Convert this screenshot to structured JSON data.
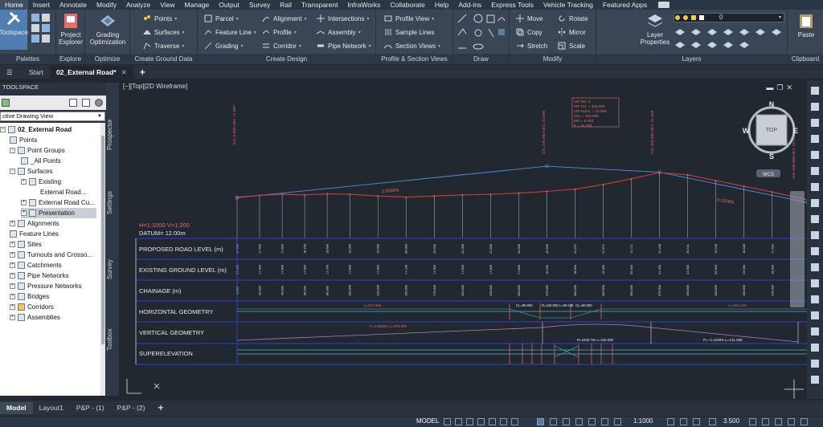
{
  "menu": [
    "Home",
    "Insert",
    "Annotate",
    "Modify",
    "Analyze",
    "View",
    "Manage",
    "Output",
    "Survey",
    "Rail",
    "Transparent",
    "InfraWorks",
    "Collaborate",
    "Help",
    "Add-ins",
    "Express Tools",
    "Vehicle Tracking",
    "Featured Apps"
  ],
  "ribbon": {
    "palettes": {
      "toolspace": "Toolspace",
      "title": "Palettes"
    },
    "explore": {
      "project_explorer": "Project Explorer",
      "title": "Explore"
    },
    "optimize": {
      "grading_optimization": "Grading Optimization",
      "title": "Optimize"
    },
    "ground": {
      "points": "Points",
      "surfaces": "Surfaces",
      "traverse": "Traverse",
      "title": "Create Ground Data"
    },
    "design": {
      "parcel": "Parcel",
      "feature_line": "Feature Line",
      "grading": "Grading",
      "alignment": "Alignment",
      "profile": "Profile",
      "corridor": "Corridor",
      "intersections": "Intersections",
      "assembly": "Assembly",
      "pipe_network": "Pipe Network",
      "title": "Create Design"
    },
    "profile_section": {
      "profile_view": "Profile View",
      "sample_lines": "Sample Lines",
      "section_views": "Section Views",
      "title": "Profile & Section Views"
    },
    "draw": {
      "title": "Draw"
    },
    "modify": {
      "move": "Move",
      "copy": "Copy",
      "stretch": "Stretch",
      "rotate": "Rotate",
      "mirror": "Mirror",
      "scale": "Scale",
      "title": "Modify"
    },
    "layers": {
      "layer_properties": "Layer Properties",
      "current_layer": "0",
      "title": "Layers"
    },
    "clipboard": {
      "paste": "Paste",
      "title": "Clipboard"
    }
  },
  "doc_tabs": {
    "start": "Start",
    "active": "02_External Road*"
  },
  "toolspace": {
    "title": "TOOLSPACE",
    "view_selector": "ctive Drawing View",
    "tree": [
      "02_External Road",
      "Points",
      "Point Groups",
      "_All Points",
      "Surfaces",
      "Existing",
      "External Road...",
      "External Road Cu...",
      "Presentation",
      "Alignments",
      "Feature Lines",
      "Sites",
      "Turnouts and Crosso...",
      "Catchments",
      "Pipe Networks",
      "Pressure Networks",
      "Bridges",
      "Corridors",
      "Assemblies"
    ],
    "side_tabs": [
      "Prospector",
      "Settings",
      "Survey",
      "Toolbox"
    ]
  },
  "viewport": {
    "label": "[−][Top][2D Wireframe]",
    "viewcube": {
      "n": "N",
      "s": "S",
      "e": "E",
      "w": "W",
      "top": "TOP",
      "wcs": "WCS"
    }
  },
  "profile": {
    "scale_note": "H=1:1000  V=1:200",
    "datum": "DATUM= 12.00m",
    "rows": [
      "PROPOSED ROAD LEVEL (m)",
      "EXISTING GROUND LEVEL (m)",
      "CHAINAGE (m)",
      "HORIZONTAL GEOMETRY",
      "VERTICAL GEOMETRY",
      "SUPERELEVATION"
    ],
    "grade_left": "2.0000%",
    "grade_right": "-4.1028%",
    "vip_box": [
      "VIP NO. 2",
      "VIP CH. = 325.000",
      "VIP ELEV. = 23.500",
      "VCL = 100.000",
      "MO = 0.763",
      "K = 16.288"
    ],
    "hg_labels": [
      "L=247.816",
      "CL=80.000",
      "R=125.000 L=80.036",
      "CL=80.000",
      "L=152.144"
    ],
    "vg_labels": [
      "P=2.0000% L=270.000",
      "P=−4.1028% L=131.558"
    ],
    "se_label": "R=1630.75x L=100.000",
    "top_labels": [
      "CH. 0.000 LEV. 17.000",
      "CH. 275.000 LEV. 22.500",
      "CH. 375.000 LEV. 21.448",
      "CH. 506.558 LEV. 16.151"
    ]
  },
  "chart_data": {
    "type": "line",
    "xlabel": "CHAINAGE (m)",
    "ylabel": "",
    "xlim": [
      0,
      506.558
    ],
    "series": [
      {
        "name": "",
        "x": [
          0,
          275,
          375,
          506.558
        ],
        "y": [
          17.0,
          22.5,
          21.448,
          16.151
        ]
      },
      {
        "name": "",
        "x": [
          0,
          20,
          40,
          60,
          80,
          100,
          125,
          150,
          175,
          200,
          225,
          250,
          275,
          300,
          325,
          350,
          375,
          400,
          425,
          450,
          475,
          506.558
        ],
        "y": [
          17.1,
          17.4,
          17.6,
          17.5,
          17.7,
          17.6,
          17.3,
          17.1,
          17.3,
          17.5,
          17.6,
          17.8,
          18.1,
          18.5,
          19.3,
          20.3,
          21.4,
          21.0,
          20.0,
          19.0,
          18.0,
          16.6
        ]
      }
    ]
  },
  "layout_tabs": [
    "Model",
    "Layout1",
    "P&P - (1)",
    "P&P - (2)"
  ],
  "status": {
    "mode": "MODEL",
    "scale": "1:1000",
    "dim": "3.500"
  }
}
